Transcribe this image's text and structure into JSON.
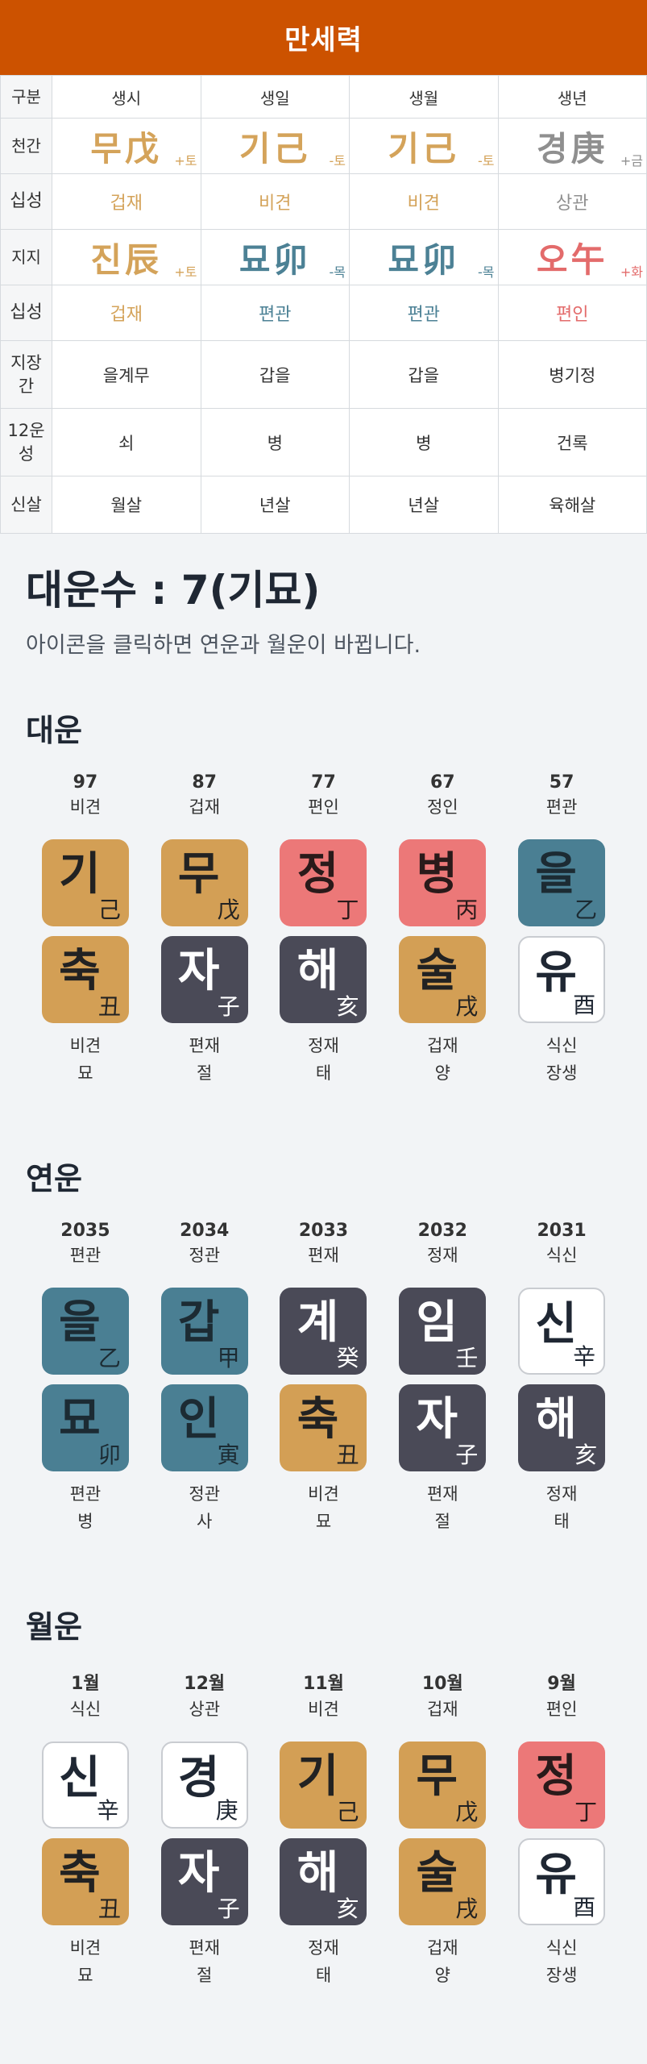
{
  "header": {
    "title": "만세력"
  },
  "table": {
    "head": {
      "label": "구분",
      "cols": [
        "생시",
        "생일",
        "생월",
        "생년"
      ]
    },
    "cheongan": {
      "label": "천간",
      "cells": [
        {
          "text": "무戊",
          "ohaeng": "+토",
          "color": "earth"
        },
        {
          "text": "기己",
          "ohaeng": "-토",
          "color": "earth"
        },
        {
          "text": "기己",
          "ohaeng": "-토",
          "color": "earth"
        },
        {
          "text": "경庚",
          "ohaeng": "+금",
          "color": "metal"
        }
      ]
    },
    "sipseong1": {
      "label": "십성",
      "cells": [
        {
          "text": "겁재",
          "color": "earth"
        },
        {
          "text": "비견",
          "color": "earth"
        },
        {
          "text": "비견",
          "color": "earth"
        },
        {
          "text": "상관",
          "color": "metal"
        }
      ]
    },
    "jiji": {
      "label": "지지",
      "cells": [
        {
          "text": "진辰",
          "ohaeng": "+토",
          "color": "earth"
        },
        {
          "text": "묘卯",
          "ohaeng": "-목",
          "color": "wood"
        },
        {
          "text": "묘卯",
          "ohaeng": "-목",
          "color": "wood"
        },
        {
          "text": "오午",
          "ohaeng": "+화",
          "color": "fire"
        }
      ]
    },
    "sipseong2": {
      "label": "십성",
      "cells": [
        {
          "text": "겁재",
          "color": "earth"
        },
        {
          "text": "편관",
          "color": "wood"
        },
        {
          "text": "편관",
          "color": "wood"
        },
        {
          "text": "편인",
          "color": "fire"
        }
      ]
    },
    "jijanggan": {
      "label": "지장간",
      "cells": [
        "을계무",
        "갑을",
        "갑을",
        "병기정"
      ]
    },
    "unseong": {
      "label": "12운성",
      "cells": [
        "쇠",
        "병",
        "병",
        "건록"
      ]
    },
    "sinsal": {
      "label": "신살",
      "cells": [
        "월살",
        "년살",
        "년살",
        "육해살"
      ]
    }
  },
  "daeunsu": {
    "title": "대운수 : 7(기묘)",
    "desc": "아이콘을 클릭하면 연운과 월운이 바뀝니다."
  },
  "daeun": {
    "title": "대운",
    "items": [
      {
        "top1": "97",
        "top2": "비견",
        "g": {
          "main": "기",
          "sub": "己",
          "el": "earth"
        },
        "j": {
          "main": "축",
          "sub": "丑",
          "el": "earth"
        },
        "bot1": "비견",
        "bot2": "묘"
      },
      {
        "top1": "87",
        "top2": "겁재",
        "g": {
          "main": "무",
          "sub": "戊",
          "el": "earth"
        },
        "j": {
          "main": "자",
          "sub": "子",
          "el": "water"
        },
        "bot1": "편재",
        "bot2": "절"
      },
      {
        "top1": "77",
        "top2": "편인",
        "g": {
          "main": "정",
          "sub": "丁",
          "el": "fire"
        },
        "j": {
          "main": "해",
          "sub": "亥",
          "el": "water"
        },
        "bot1": "정재",
        "bot2": "태"
      },
      {
        "top1": "67",
        "top2": "정인",
        "g": {
          "main": "병",
          "sub": "丙",
          "el": "fire"
        },
        "j": {
          "main": "술",
          "sub": "戌",
          "el": "earth"
        },
        "bot1": "겁재",
        "bot2": "양"
      },
      {
        "top1": "57",
        "top2": "편관",
        "g": {
          "main": "을",
          "sub": "乙",
          "el": "wood"
        },
        "j": {
          "main": "유",
          "sub": "酉",
          "el": "metal"
        },
        "bot1": "식신",
        "bot2": "장생"
      }
    ]
  },
  "yeonun": {
    "title": "연운",
    "items": [
      {
        "top1": "2035",
        "top2": "편관",
        "g": {
          "main": "을",
          "sub": "乙",
          "el": "wood"
        },
        "j": {
          "main": "묘",
          "sub": "卯",
          "el": "wood"
        },
        "bot1": "편관",
        "bot2": "병"
      },
      {
        "top1": "2034",
        "top2": "정관",
        "g": {
          "main": "갑",
          "sub": "甲",
          "el": "wood"
        },
        "j": {
          "main": "인",
          "sub": "寅",
          "el": "wood"
        },
        "bot1": "정관",
        "bot2": "사"
      },
      {
        "top1": "2033",
        "top2": "편재",
        "g": {
          "main": "계",
          "sub": "癸",
          "el": "water"
        },
        "j": {
          "main": "축",
          "sub": "丑",
          "el": "earth"
        },
        "bot1": "비견",
        "bot2": "묘"
      },
      {
        "top1": "2032",
        "top2": "정재",
        "g": {
          "main": "임",
          "sub": "壬",
          "el": "water"
        },
        "j": {
          "main": "자",
          "sub": "子",
          "el": "water"
        },
        "bot1": "편재",
        "bot2": "절"
      },
      {
        "top1": "2031",
        "top2": "식신",
        "g": {
          "main": "신",
          "sub": "辛",
          "el": "metal"
        },
        "j": {
          "main": "해",
          "sub": "亥",
          "el": "water"
        },
        "bot1": "정재",
        "bot2": "태"
      }
    ]
  },
  "wolun": {
    "title": "월운",
    "items": [
      {
        "top1": "1월",
        "top2": "식신",
        "g": {
          "main": "신",
          "sub": "辛",
          "el": "metal"
        },
        "j": {
          "main": "축",
          "sub": "丑",
          "el": "earth"
        },
        "bot1": "비견",
        "bot2": "묘"
      },
      {
        "top1": "12월",
        "top2": "상관",
        "g": {
          "main": "경",
          "sub": "庚",
          "el": "metal"
        },
        "j": {
          "main": "자",
          "sub": "子",
          "el": "water"
        },
        "bot1": "편재",
        "bot2": "절"
      },
      {
        "top1": "11월",
        "top2": "비견",
        "g": {
          "main": "기",
          "sub": "己",
          "el": "earth"
        },
        "j": {
          "main": "해",
          "sub": "亥",
          "el": "water"
        },
        "bot1": "정재",
        "bot2": "태"
      },
      {
        "top1": "10월",
        "top2": "겁재",
        "g": {
          "main": "무",
          "sub": "戊",
          "el": "earth"
        },
        "j": {
          "main": "술",
          "sub": "戌",
          "el": "earth"
        },
        "bot1": "겁재",
        "bot2": "양"
      },
      {
        "top1": "9월",
        "top2": "편인",
        "g": {
          "main": "정",
          "sub": "丁",
          "el": "fire"
        },
        "j": {
          "main": "유",
          "sub": "酉",
          "el": "metal"
        },
        "bot1": "식신",
        "bot2": "장생"
      }
    ]
  },
  "colors": {
    "header": "#cc5200",
    "earth": "#d39f55",
    "wood": "#4a7f93",
    "fire": "#ec7878",
    "water": "#4a4a57",
    "metal": "#ffffff"
  }
}
